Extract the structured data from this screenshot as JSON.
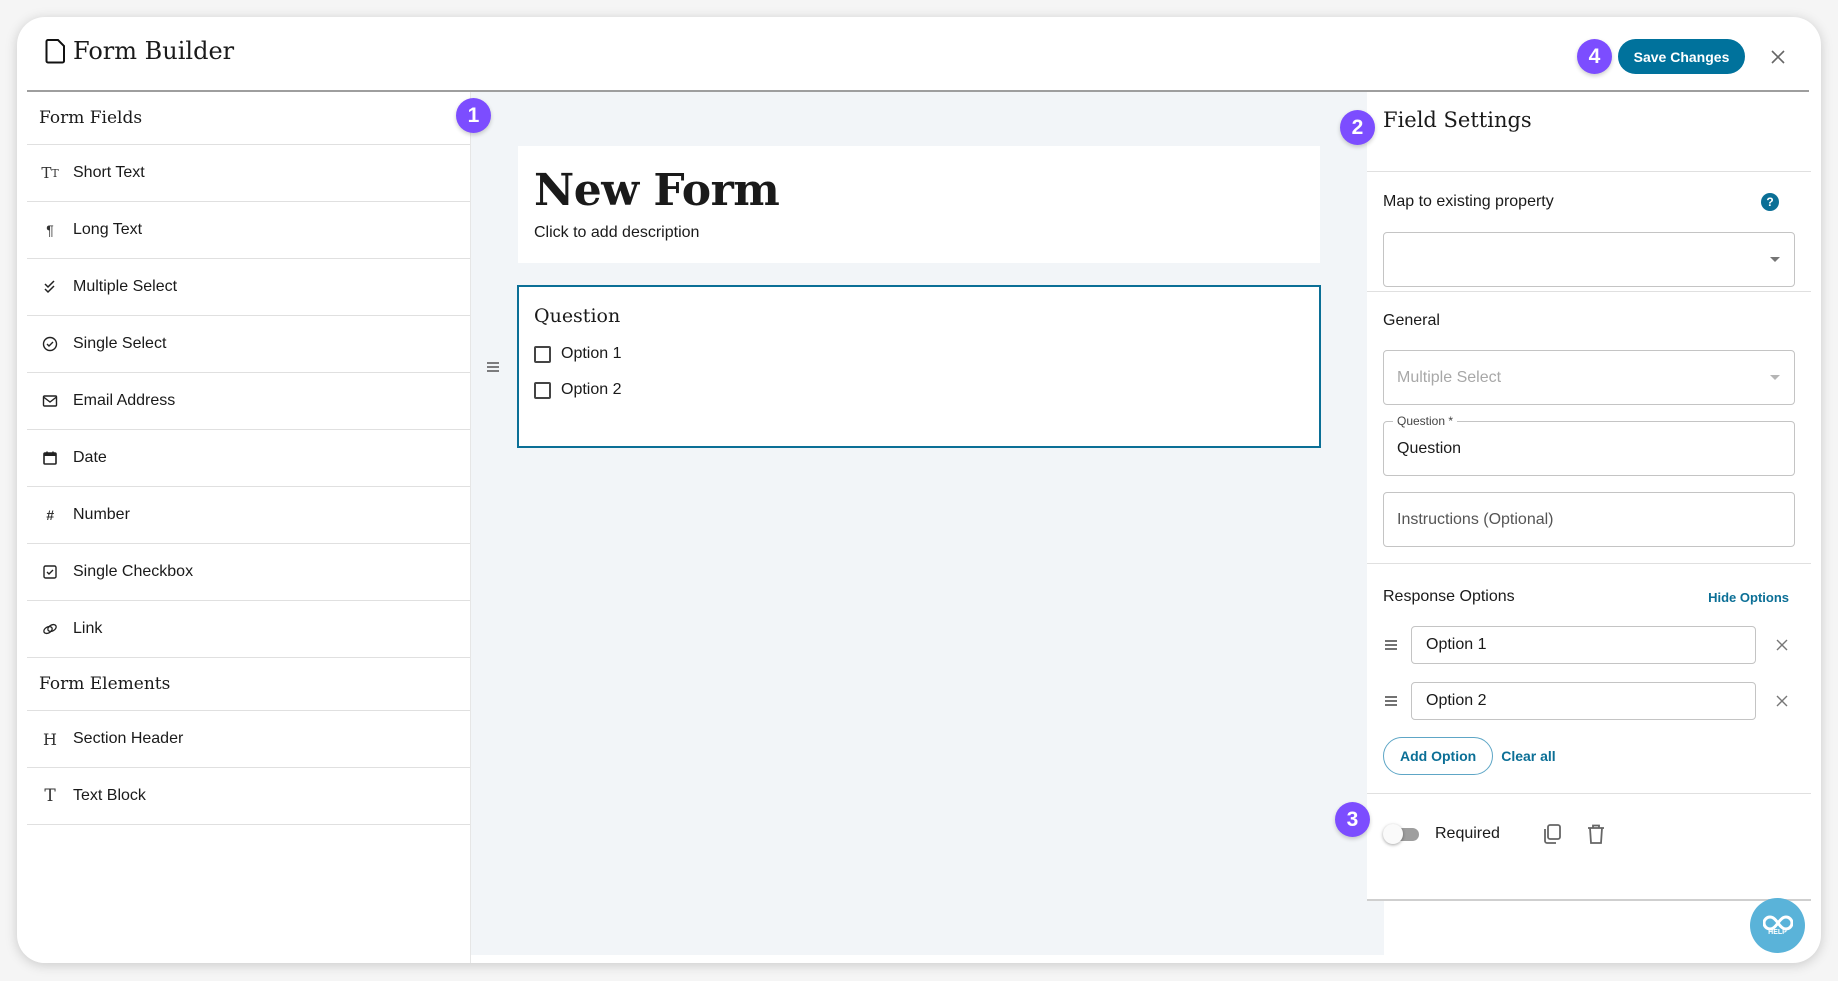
{
  "header": {
    "title": "Form Builder",
    "save_label": "Save Changes",
    "badges": {
      "b1": "1",
      "b2": "2",
      "b3": "3",
      "b4": "4"
    }
  },
  "sidebar": {
    "fields_heading": "Form Fields",
    "fields": [
      {
        "label": "Short Text",
        "icon": "text-size-icon"
      },
      {
        "label": "Long Text",
        "icon": "paragraph-icon"
      },
      {
        "label": "Multiple Select",
        "icon": "double-check-icon"
      },
      {
        "label": "Single Select",
        "icon": "check-circle-icon"
      },
      {
        "label": "Email Address",
        "icon": "envelope-icon"
      },
      {
        "label": "Date",
        "icon": "calendar-icon"
      },
      {
        "label": "Number",
        "icon": "hash-icon"
      },
      {
        "label": "Single Checkbox",
        "icon": "checkbox-icon"
      },
      {
        "label": "Link",
        "icon": "link-icon"
      }
    ],
    "elements_heading": "Form Elements",
    "elements": [
      {
        "label": "Section Header",
        "icon": "heading-icon"
      },
      {
        "label": "Text Block",
        "icon": "text-icon"
      }
    ]
  },
  "canvas": {
    "form_title": "New Form",
    "form_description": "Click to add description",
    "question": {
      "title": "Question",
      "options": [
        "Option 1",
        "Option 2"
      ]
    }
  },
  "panel": {
    "title": "Field Settings",
    "map_label": "Map to existing property",
    "map_value": "",
    "general_label": "General",
    "field_type": "Multiple Select",
    "question_label": "Question *",
    "question_value": "Question",
    "instructions_placeholder": "Instructions (Optional)",
    "response_label": "Response Options",
    "hide_options": "Hide Options",
    "options": [
      "Option 1",
      "Option 2"
    ],
    "add_option": "Add Option",
    "clear_all": "Clear all",
    "required_label": "Required",
    "required_on": false
  },
  "help": {
    "label": "HELP"
  },
  "colors": {
    "accent": "#00729c",
    "badge": "#7c4dff",
    "canvas_bg": "#f2f5f8",
    "help_bg": "#5ab3d9"
  }
}
